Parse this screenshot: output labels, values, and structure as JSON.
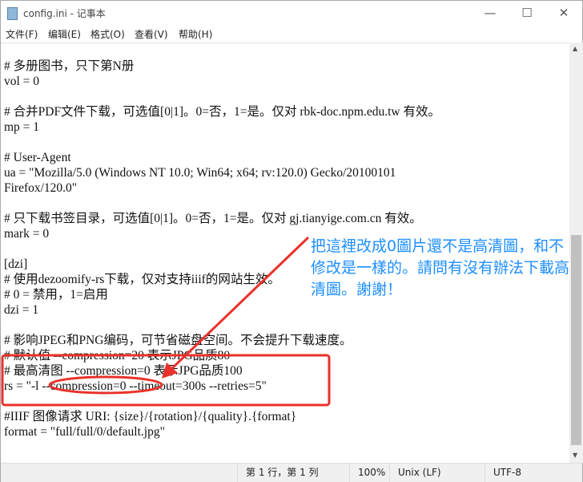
{
  "window": {
    "title": "config.ini - 记事本",
    "minimize": "—",
    "maximize": "☐",
    "close": "✕"
  },
  "menu": [
    "文件(F)",
    "编辑(E)",
    "格式(O)",
    "查看(V)",
    "帮助(H)"
  ],
  "lines": [
    "",
    "# 多册图书，只下第N册",
    "vol = 0",
    "",
    "# 合并PDF文件下载，可选值[0|1]。0=否，1=是。仅对 rbk-doc.npm.edu.tw 有效。",
    "mp = 1",
    "",
    "# User-Agent",
    "ua = \"Mozilla/5.0 (Windows NT 10.0; Win64; x64; rv:120.0) Gecko/20100101",
    "Firefox/120.0\"",
    "",
    "# 只下载书签目录，可选值[0|1]。0=否，1=是。仅对 gj.tianyige.com.cn 有效。",
    "mark = 0",
    "",
    "[dzi]",
    "# 使用dezoomify-rs下载，仅对支持iiif的网站生效。",
    "# 0 = 禁用，1=启用",
    "dzi = 1",
    "",
    "# 影响JPEG和PNG编码，可节省磁盘空间。不会提升下载速度。",
    "# 默认值 --compression=20 表示JPG品质80",
    "# 最高清图 --compression=0 表示JPG品质100",
    "rs = \"-l --compression=0 --timeout=300s --retries=5\"",
    "",
    "#IIIF 图像请求 URI: {size}/{rotation}/{quality}.{format}",
    "format = \"full/full/0/default.jpg\""
  ],
  "status": {
    "position": "第 1 行，第 1 列",
    "zoom": "100%",
    "line_ending": "Unix (LF)",
    "encoding": "UTF-8"
  },
  "annotation": {
    "text": "把這裡改成0圖片還不是高清圖，和不修改是一樣的。請問有沒有辦法下載高清圖。謝謝！",
    "color": "#1e8fff",
    "mark_color": "#e8322b"
  }
}
